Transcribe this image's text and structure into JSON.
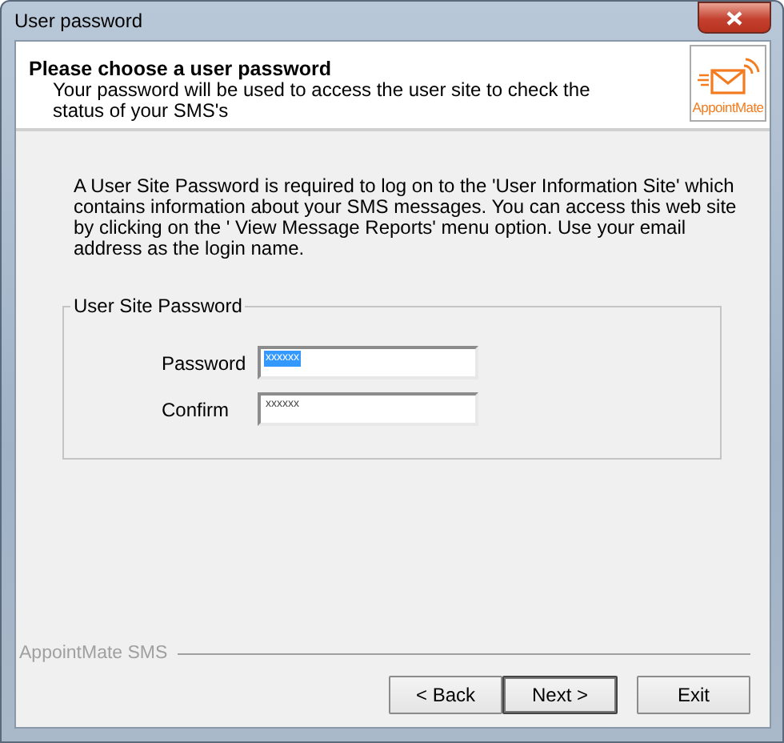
{
  "window": {
    "title": "User password"
  },
  "header": {
    "title": "Please choose a user password",
    "subtitle": "Your password will be used to access the user site to check the status of your SMS's",
    "logo_text": "AppointMate"
  },
  "intro": "A User Site Password is required to log on to the 'User Information Site' which contains information about your SMS messages. You can access this web site by clicking on the ' View Message Reports' menu option. Use your email address as the login name.",
  "group": {
    "title": "User Site Password",
    "fields": [
      {
        "label": "Password",
        "value": "xxxxxx",
        "text_selected": true
      },
      {
        "label": "Confirm",
        "value": "xxxxxx",
        "text_selected": false
      }
    ]
  },
  "footer": {
    "brand": "AppointMate SMS"
  },
  "buttons": [
    {
      "label": "< Back",
      "default": false
    },
    {
      "label": "Next >",
      "default": true
    },
    {
      "label": "Exit",
      "default": false
    }
  ]
}
